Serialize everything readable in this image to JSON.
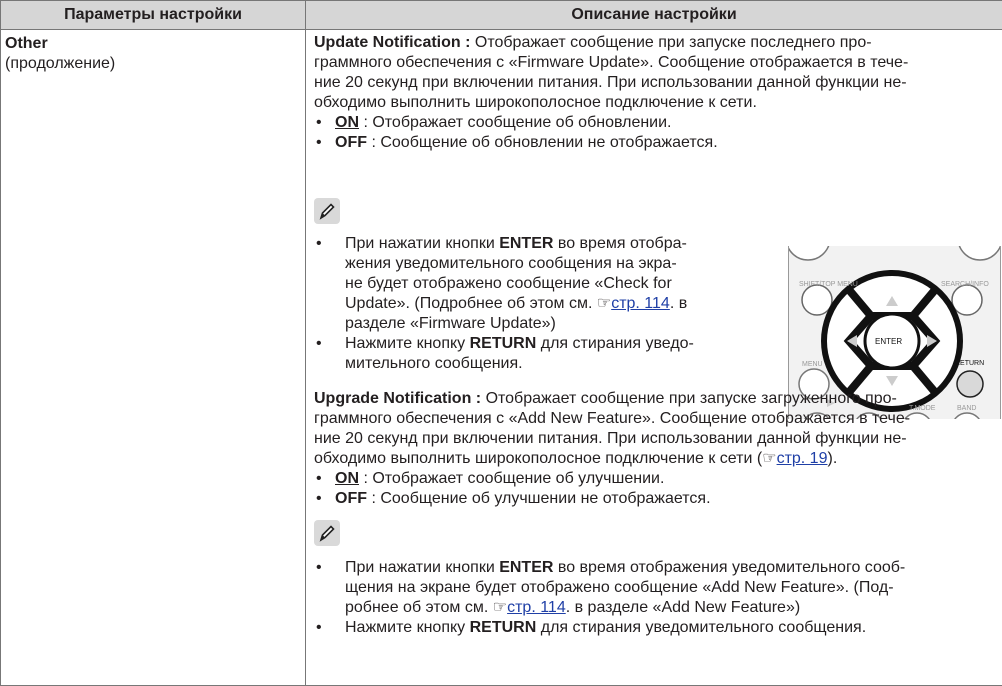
{
  "header": {
    "col1": "Параметры настройки",
    "col2": "Описание настройки"
  },
  "left": {
    "title": "Other",
    "subtitle": "(продолжение)"
  },
  "update": {
    "title": "Update Notification :",
    "l1": "Отображает сообщение при запуске последнего про-",
    "l2": "граммного обеспечения с «Firmware Update». Сообщение отображается в тече-",
    "l3": "ние 20 секунд при включении питания. При использовании данной функции не-",
    "l4": "обходимо выполнить широкополосное подключение к сети.",
    "on_label": "ON",
    "on_text": " : Отображает сообщение об обновлении.",
    "off_label": "OFF",
    "off_text": " : Сообщение об обновлении не отображается."
  },
  "note1": {
    "l1a": "При нажатии кнопки ",
    "l1b": "ENTER",
    "l1c": " во время отобра-",
    "l2": "жения уведомительного сообщения на экра-",
    "l3": "не будет отображено сообщение «Check for",
    "l4a": "Update». (Подробнее об этом см. ☞",
    "l4link": "стр. 114",
    "l4b": ". в",
    "l5": "разделе «Firmware Update»)",
    "l6a": "Нажмите кнопку ",
    "l6b": "RETURN",
    "l6c": " для стирания уведо-",
    "l7": "мительного сообщения."
  },
  "remote": {
    "shift": "SHIFT/TOP MENU",
    "search": "SEARCH/INFO",
    "enter": "ENTER",
    "menu": "MENU",
    "return": "RETURN",
    "tmode": "T.MODE",
    "band": "BAND"
  },
  "upgrade": {
    "title": "Upgrade Notification :",
    "l1": "Отображает сообщение при запуске загруженного про-",
    "l2": "граммного обеспечения с «Add New Feature». Сообщение отображается в тече-",
    "l3": "ние 20 секунд при включении питания. При использовании данной функции не-",
    "l4a": "обходимо выполнить широкополосное подключение к сети (☞",
    "l4link": "стр. 19",
    "l4b": ").",
    "on_label": "ON",
    "on_text": " : Отображает сообщение об улучшении.",
    "off_label": "OFF",
    "off_text": " : Сообщение об улучшении не отображается."
  },
  "note2": {
    "l1a": "При нажатии кнопки ",
    "l1b": "ENTER",
    "l1c": " во время отображения уведомительного сооб-",
    "l2": "щения на экране будет отображено сообщение «Add New Feature». (Под-",
    "l3a": "робнее об этом см. ☞",
    "l3link": "стр. 114",
    "l3b": ". в разделе «Add New Feature»)",
    "l4a": "Нажмите кнопку ",
    "l4b": "RETURN",
    "l4c": " для стирания уведомительного сообщения."
  },
  "bullet": "•"
}
